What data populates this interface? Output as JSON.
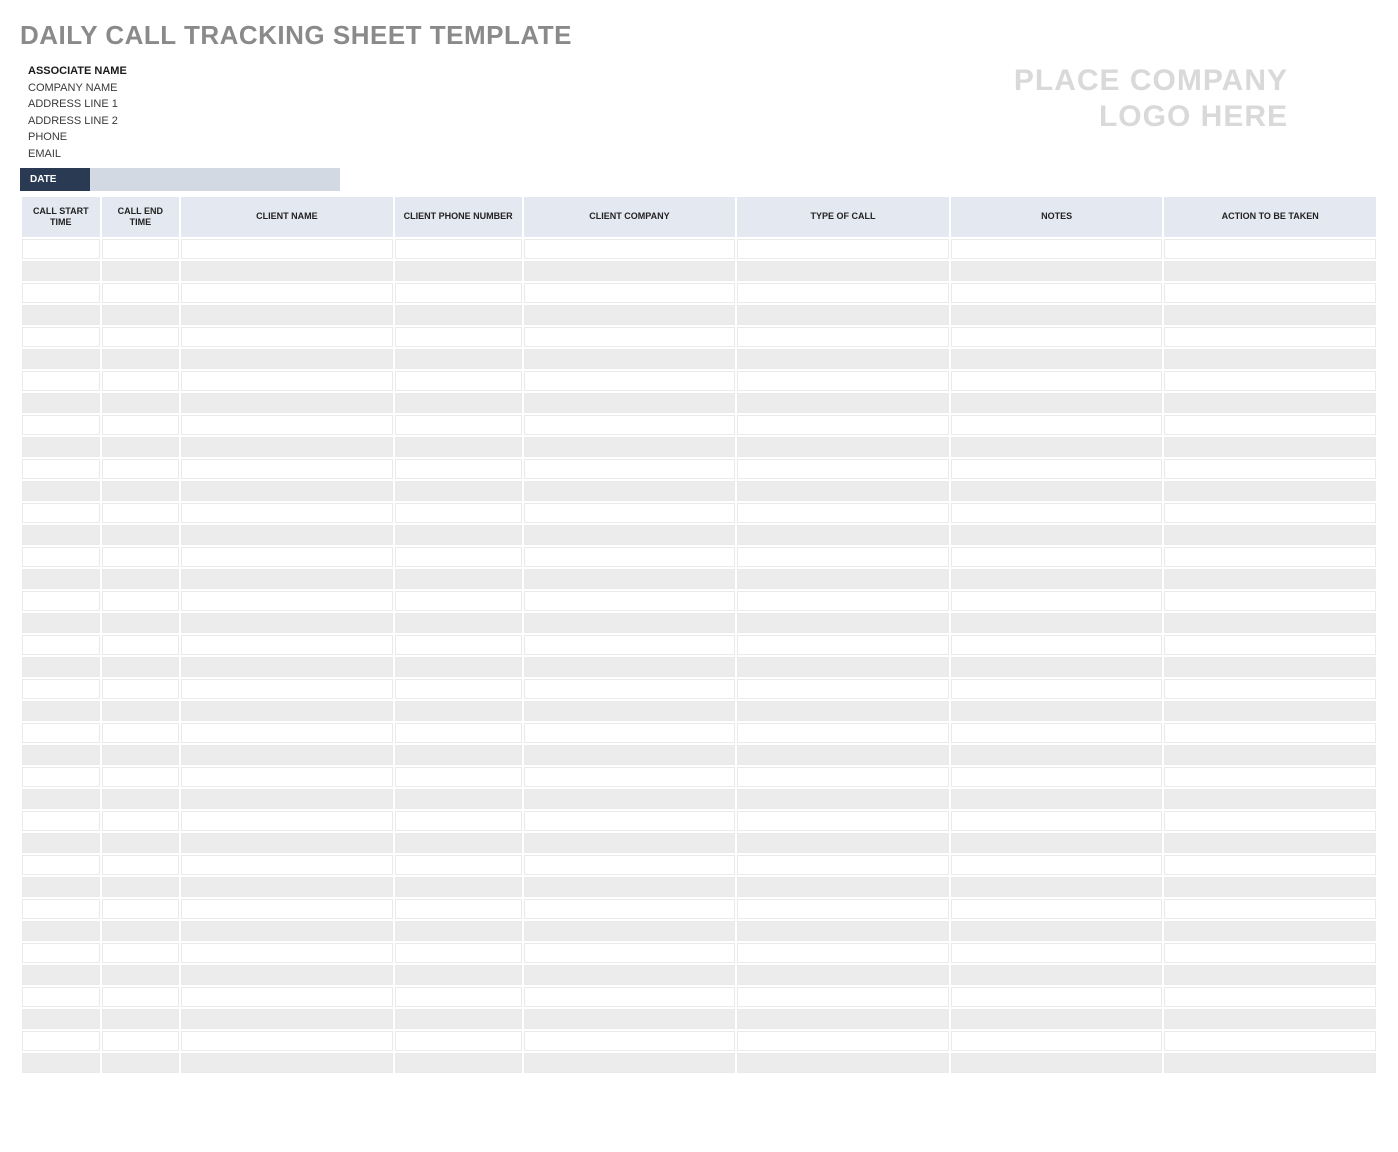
{
  "title": "DAILY CALL TRACKING SHEET TEMPLATE",
  "meta": {
    "associate_label": "ASSOCIATE NAME",
    "company": "COMPANY NAME",
    "address1": "ADDRESS LINE 1",
    "address2": "ADDRESS LINE 2",
    "phone": "PHONE",
    "email": "EMAIL"
  },
  "logo_placeholder_line1": "PLACE COMPANY",
  "logo_placeholder_line2": "LOGO HERE",
  "date_label": "DATE",
  "date_value": "",
  "columns": {
    "start": "CALL START TIME",
    "end": "CALL END TIME",
    "client_name": "CLIENT NAME",
    "client_phone": "CLIENT PHONE NUMBER",
    "client_company": "CLIENT COMPANY",
    "type": "TYPE OF CALL",
    "notes": "NOTES",
    "action": "ACTION TO BE TAKEN"
  },
  "row_count": 38
}
